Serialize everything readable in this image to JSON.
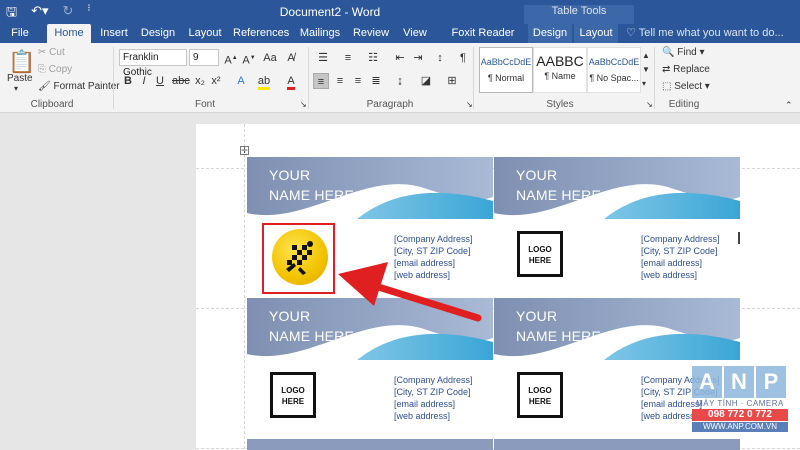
{
  "titlebar": {
    "doc_title": "Document2 - Word",
    "context_title": "Table Tools"
  },
  "tabs": [
    {
      "label": "File"
    },
    {
      "label": "Home"
    },
    {
      "label": "Insert"
    },
    {
      "label": "Design"
    },
    {
      "label": "Layout"
    },
    {
      "label": "References"
    },
    {
      "label": "Mailings"
    },
    {
      "label": "Review"
    },
    {
      "label": "View"
    },
    {
      "label": "Foxit Reader PDF"
    },
    {
      "label": "Design"
    },
    {
      "label": "Layout"
    }
  ],
  "tell_me": "Tell me what you want to do...",
  "clipboard": {
    "paste": "Paste",
    "cut": "Cut",
    "copy": "Copy",
    "format_painter": "Format Painter",
    "label": "Clipboard"
  },
  "font": {
    "family": "Franklin Gothic",
    "size": "9",
    "label": "Font"
  },
  "paragraph": {
    "label": "Paragraph"
  },
  "styles": {
    "items": [
      {
        "sample": "AaBbCcDdE",
        "name": "¶ Normal"
      },
      {
        "sample": "AABBC",
        "name": "¶ Name"
      },
      {
        "sample": "AaBbCcDdE",
        "name": "¶ No Spac..."
      }
    ],
    "label": "Styles"
  },
  "editing": {
    "find": "Find",
    "replace": "Replace",
    "select": "Select",
    "label": "Editing"
  },
  "cards": [
    {
      "name_line1": "YOUR",
      "name_line2": "NAME HERE",
      "address": "[Company Address]",
      "city": "[City, ST  ZIP Code]",
      "email": "[email address]",
      "web": "[web address]",
      "logo_line1": "",
      "logo_line2": ""
    },
    {
      "name_line1": "YOUR",
      "name_line2": "NAME HERE",
      "address": "[Company Address]",
      "city": "[City, ST  ZIP Code]",
      "email": "[email address]",
      "web": "[web address]",
      "logo_line1": "LOGO",
      "logo_line2": "HERE"
    },
    {
      "name_line1": "YOUR",
      "name_line2": "NAME HERE",
      "address": "[Company Address]",
      "city": "[City, ST  ZIP Code]",
      "email": "[email address]",
      "web": "[web address]",
      "logo_line1": "LOGO",
      "logo_line2": "HERE"
    },
    {
      "name_line1": "YOUR",
      "name_line2": "NAME HERE",
      "address": "[Company Address]",
      "city": "[City, ST  ZIP Code]",
      "email": "[email address]",
      "web": "[web address]",
      "logo_line1": "LOGO",
      "logo_line2": "HERE"
    }
  ],
  "watermark": {
    "letters": [
      "A",
      "N",
      "P"
    ],
    "subtitle": "MÁY TÍNH · CAMERA",
    "phone": "098 772 0 772",
    "website": "WWW.ANP.COM.VN"
  },
  "colors": {
    "word_blue": "#2b579a",
    "annotation_red": "#e02020",
    "logo_yellow": "#f2c200"
  }
}
